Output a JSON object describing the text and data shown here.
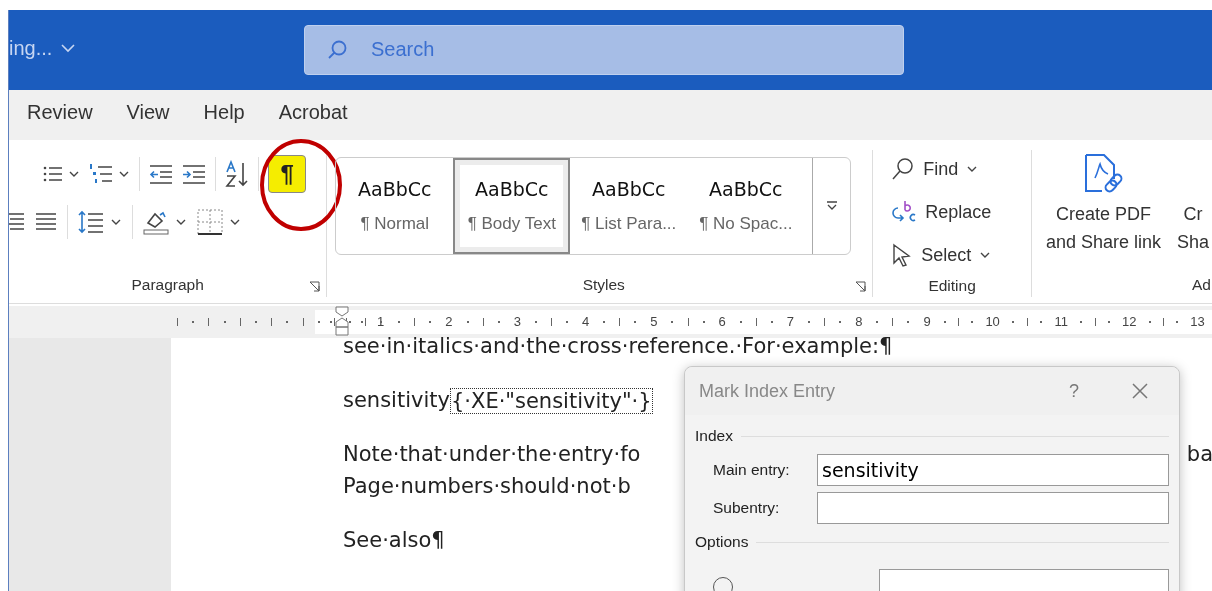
{
  "title_bar": {
    "doc_status": "ing...",
    "search": {
      "placeholder": "Search"
    }
  },
  "tabs": [
    {
      "label": "Review",
      "selected": false
    },
    {
      "label": "View",
      "selected": false
    },
    {
      "label": "Help",
      "selected": false
    },
    {
      "label": "Acrobat",
      "selected": false
    }
  ],
  "ribbon": {
    "paragraph": {
      "label": "Paragraph",
      "show_marks": {
        "symbol": "¶",
        "selected": true
      }
    },
    "styles": {
      "label": "Styles",
      "items": [
        {
          "preview": "AaBbCc",
          "name": "¶ Normal",
          "selected": false
        },
        {
          "preview": "AaBbCc",
          "name": "¶ Body Text",
          "selected": true
        },
        {
          "preview": "AaBbCc",
          "name": "¶ List Para...",
          "selected": false
        },
        {
          "preview": "AaBbCc",
          "name": "¶ No Spac...",
          "selected": false
        }
      ]
    },
    "editing": {
      "label": "Editing",
      "items": [
        {
          "kind": "find",
          "label": "Find",
          "has_menu": true
        },
        {
          "kind": "replace",
          "label": "Replace",
          "has_menu": false
        },
        {
          "kind": "select",
          "label": "Select",
          "has_menu": true
        }
      ]
    },
    "adobe": {
      "label": "Ad",
      "buttons": [
        {
          "lines": [
            "Create PDF",
            "and Share link"
          ]
        },
        {
          "lines": [
            "Cr",
            "Sha"
          ]
        }
      ]
    }
  },
  "ruler": {
    "numbers": [
      "1",
      "2",
      "3",
      "4",
      "5",
      "6",
      "7",
      "8",
      "9",
      "10",
      "11",
      "12",
      "13"
    ]
  },
  "document": {
    "paragraphs": [
      {
        "text": "see·in·italics·and·the·cross·reference.·For·example:¶"
      },
      {
        "text": "sensitivity",
        "field": "{·XE·\"sensitivity\"·}"
      },
      {
        "text": "Note·that·under·the·entry·fo",
        "tail": "ba"
      },
      {
        "text": "Page·numbers·should·not·b"
      },
      {
        "text": "See·also¶"
      }
    ]
  },
  "dialog": {
    "title": "Mark Index Entry",
    "help": "?",
    "section_index": "Index",
    "main_entry": {
      "label": "Main entry:",
      "value": "sensitivity"
    },
    "subentry": {
      "label": "Subentry:"
    },
    "section_options": "Options",
    "cross_reference": {
      "selected": false
    }
  }
}
